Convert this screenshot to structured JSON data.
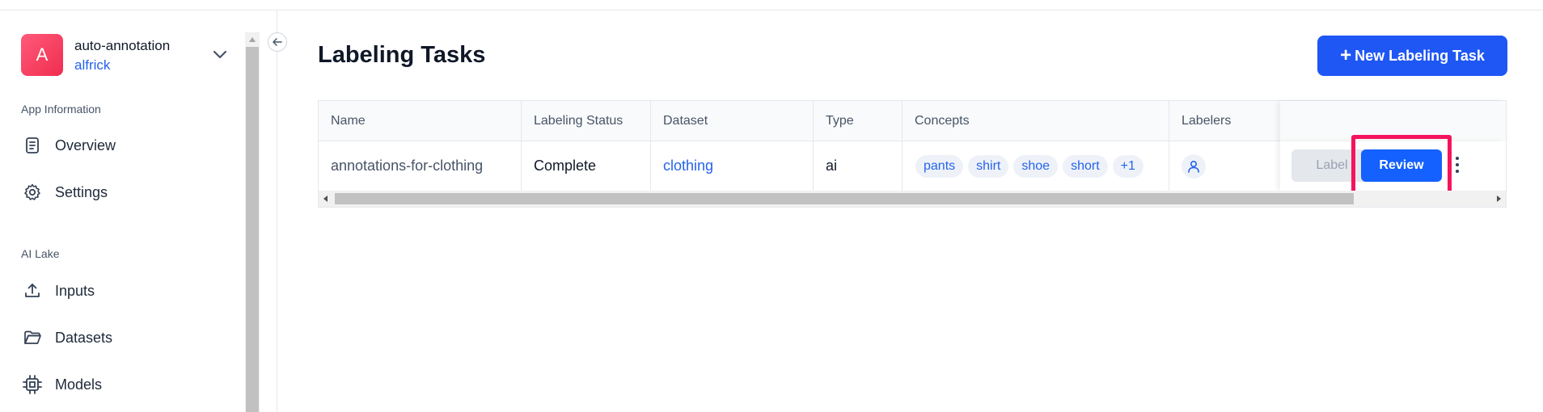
{
  "app": {
    "avatar_letter": "A",
    "name": "auto-annotation",
    "user": "alfrick"
  },
  "sidebar": {
    "section_app_info": "App Information",
    "section_ai_lake": "AI Lake",
    "items": [
      {
        "label": "Overview",
        "icon": "document-icon"
      },
      {
        "label": "Settings",
        "icon": "gear-icon"
      },
      {
        "label": "Inputs",
        "icon": "upload-icon"
      },
      {
        "label": "Datasets",
        "icon": "folder-icon"
      },
      {
        "label": "Models",
        "icon": "chip-icon"
      }
    ]
  },
  "main": {
    "title": "Labeling Tasks",
    "new_task_label": "New Labeling Task"
  },
  "table": {
    "headers": {
      "name": "Name",
      "status": "Labeling Status",
      "dataset": "Dataset",
      "type": "Type",
      "concepts": "Concepts",
      "labelers": "Labelers"
    },
    "rows": [
      {
        "name": "annotations-for-clothing",
        "status": "Complete",
        "dataset": "clothing",
        "type": "ai",
        "concepts": [
          "pants",
          "shirt",
          "shoe",
          "short"
        ],
        "concepts_more": "+1",
        "label_button": "Label",
        "review_button": "Review"
      }
    ]
  },
  "colors": {
    "primary": "#1f57f5",
    "highlight": "#f5145c",
    "link": "#2563eb"
  }
}
